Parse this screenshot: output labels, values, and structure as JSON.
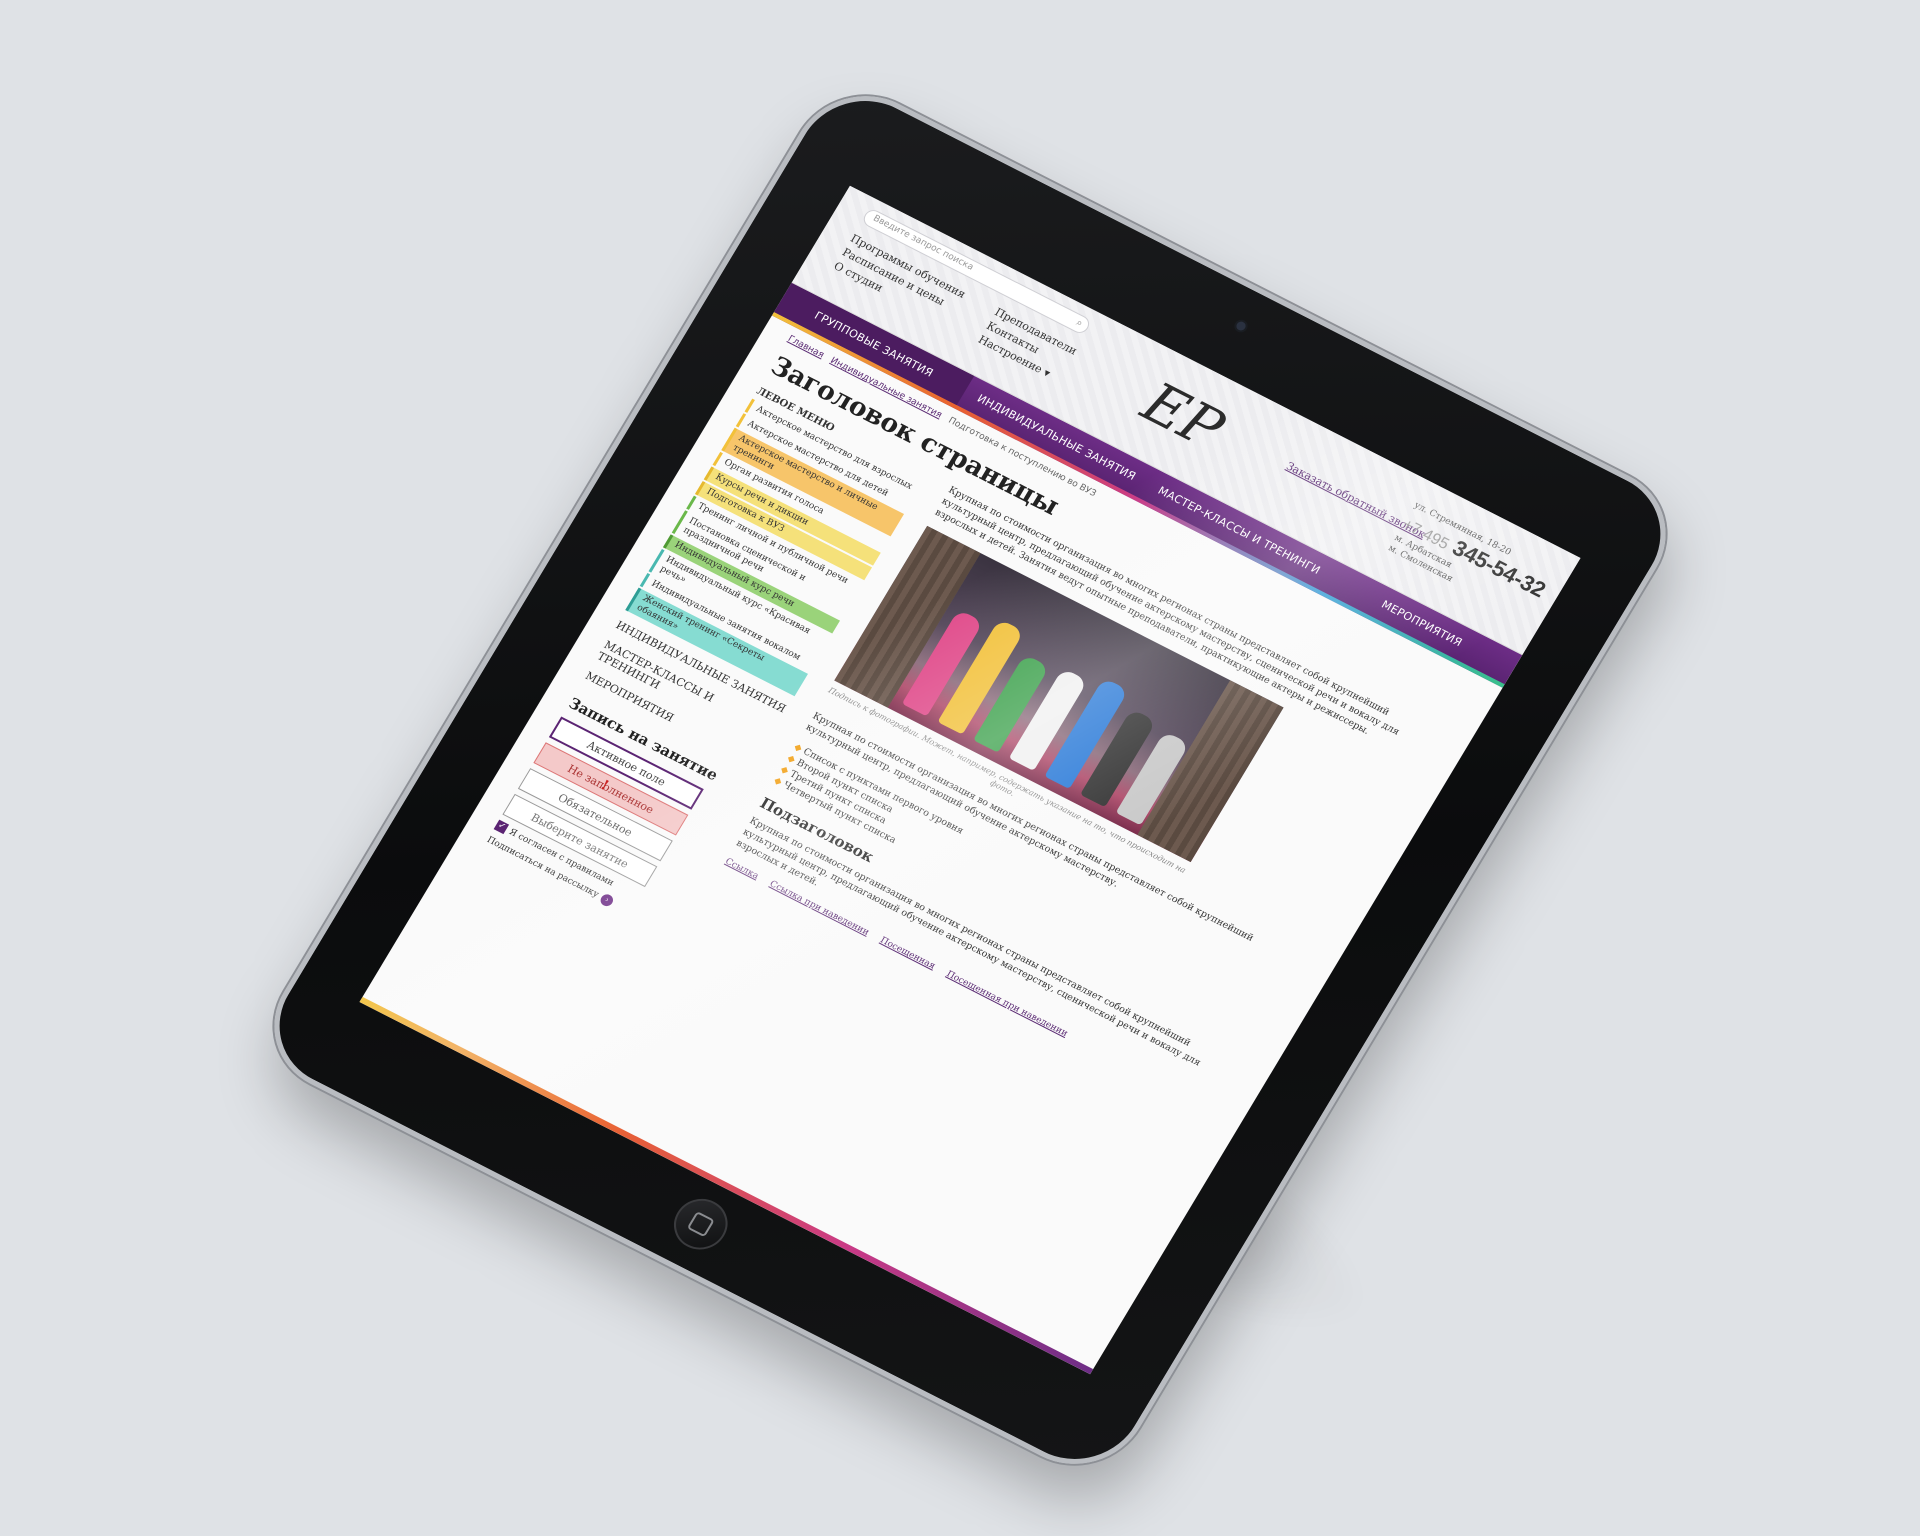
{
  "header": {
    "search_placeholder": "Введите запрос поиска",
    "links_left": [
      "Программы обучения",
      "Расписание и цены",
      "О студии"
    ],
    "links_right": [
      "Преподаватели",
      "Контакты",
      "Настроение ▾"
    ],
    "logo": "EP",
    "callback": "Заказать обратный звонок",
    "address": "ул. Стремянная, 18-20",
    "phone_prefix": "+7 495",
    "phone_number": "345-54-32",
    "metro": [
      "м. Арбатская",
      "м. Смоленская"
    ]
  },
  "nav": [
    {
      "label": "Групповые занятия",
      "active": true
    },
    {
      "label": "Индивидуальные занятия",
      "active": false
    },
    {
      "label": "Мастер-классы и тренинги",
      "active": false
    },
    {
      "label": "Мероприятия",
      "active": false
    }
  ],
  "breadcrumbs": [
    "Главная",
    "Индивидуальные занятия",
    "Подготовка к поступлению во ВУЗ"
  ],
  "page_title": "Заголовок страницы",
  "sidebar": {
    "heading": "Левое меню",
    "items": [
      {
        "label": "Актерское мастерство для взрослых",
        "style": "plain"
      },
      {
        "label": "Актерское мастерство для детей",
        "style": "plain"
      },
      {
        "label": "Актерское мастерство и личные тренинги",
        "style": "hl-orange"
      },
      {
        "label": "Орган развития голоса",
        "style": "plain"
      },
      {
        "label": "Курсы речи и дикции",
        "style": "hl-yellow"
      },
      {
        "label": "Подготовка к ВУЗ",
        "style": "hl-yellow"
      },
      {
        "label": "Тренинг личной и публичной речи",
        "style": "green"
      },
      {
        "label": "Постановка сценической и праздничной речи",
        "style": "green"
      },
      {
        "label": "Индивидуальный курс речи",
        "style": "hl-green"
      },
      {
        "label": "Индивидуальный курс «Красивая речь»",
        "style": "teal"
      },
      {
        "label": "Индивидуальные занятия вокалом",
        "style": "teal"
      },
      {
        "label": "Женский тренинг «Секреты обаяния»",
        "style": "hl-teal"
      }
    ],
    "main_links": [
      "Индивидуальные занятия",
      "Мастер-классы и тренинги",
      "Мероприятия"
    ]
  },
  "form": {
    "title": "Запись на занятие",
    "active_field": "Активное поле",
    "error_field": "Не заполненное",
    "required_field": "Обязательное",
    "select_field": "Выберите занятие",
    "checkbox_label_1": "Я согласен с правилами",
    "checkbox_label_2": "Подписаться на рассылку"
  },
  "main": {
    "para1": "Крупная по стоимости организация во многих регионах страны представляет собой крупнейший культурный центр, предлагающий обучение актерскому мастерству, сценической речи и вокалу для взрослых и детей. Занятия ведут опытные преподаватели, практикующие актеры и режиссеры.",
    "caption": "Подпись к фотографии. Может, например, содержать указание на то, что происходит на фото.",
    "para2": "Крупная по стоимости организация во многих регионах страны представляет собой крупнейший культурный центр, предлагающий обучение актерскому мастерству.",
    "bullets": [
      "Список с пунктами первого уровня",
      "Второй пункт списка",
      "Третий пункт списка",
      "Четвертый пункт списка"
    ],
    "subtitle": "Подзаголовок",
    "para3": "Крупная по стоимости организация во многих регионах страны представляет собой крупнейший культурный центр, предлагающий обучение актерскому мастерству, сценической речи и вокалу для взрослых и детей.",
    "links": [
      "Ссылка",
      "Ссылка при наведении",
      "Посещенная",
      "Посещенная при наведении"
    ]
  },
  "colors": {
    "brand_purple": "#5b2473",
    "accent_orange": "#f2a21a",
    "error_red": "#f4c9c9"
  }
}
